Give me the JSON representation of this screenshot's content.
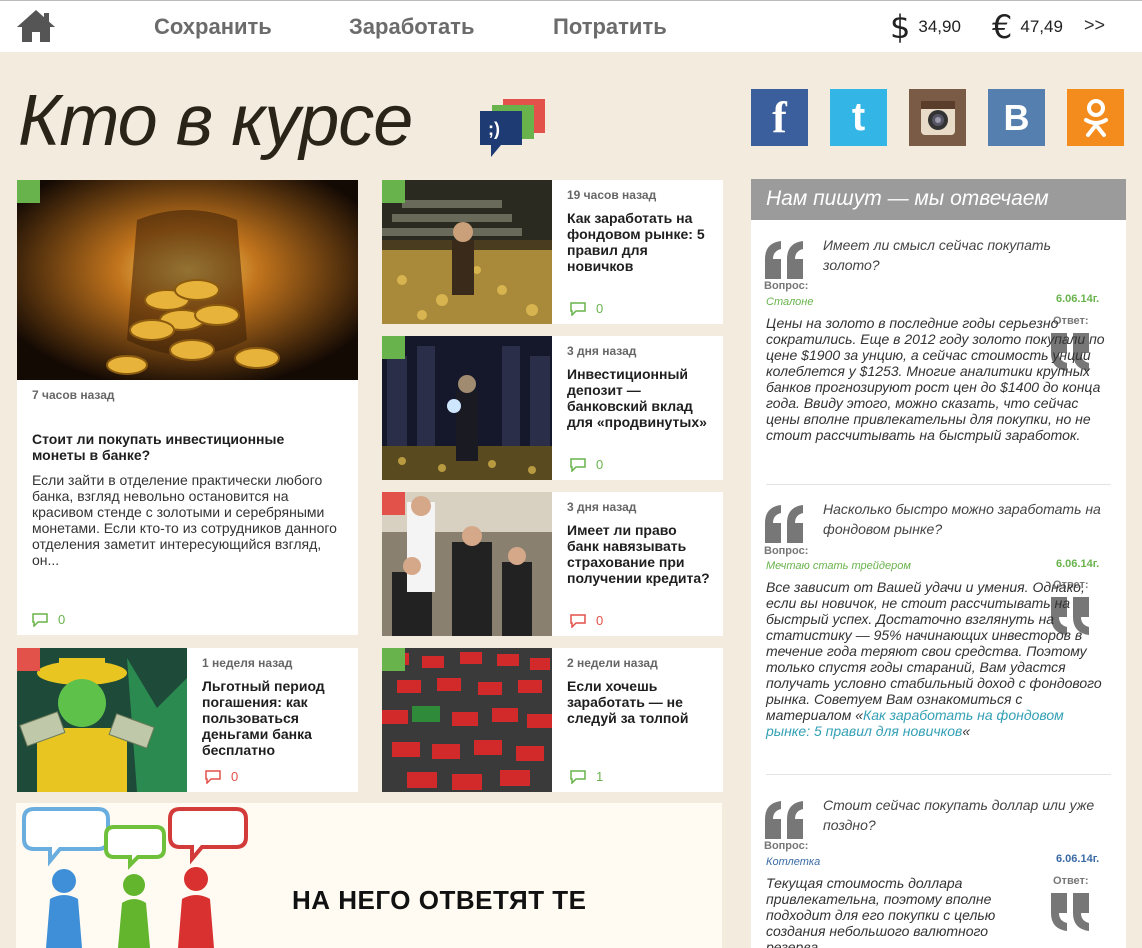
{
  "nav": {
    "items": [
      "Сохранить",
      "Заработать",
      "Потратить"
    ]
  },
  "currency": {
    "usd_symbol": "$",
    "usd_value": "34,90",
    "eur_symbol": "€",
    "eur_value": "47,49",
    "more": ">>"
  },
  "site": {
    "title": "Кто в курсе",
    "bubble_text": ";)"
  },
  "social": [
    "facebook-icon",
    "twitter-icon",
    "instagram-icon",
    "vk-icon",
    "odnoklassniki-icon"
  ],
  "articles": [
    {
      "time": "7 часов назад",
      "title": "Стоит ли покупать инвестиционные монеты в банке?",
      "excerpt": "Если зайти в отделение практически любого банка, взгляд невольно остановится на красивом стенде с золотыми и серебряными монетами.  Если кто-то из сотрудников данного отделения заметит интересующийся взгляд, он...",
      "comments": "0"
    },
    {
      "time": "19 часов назад",
      "title": "Как заработать на фондовом рынке: 5 правил для новичков",
      "comments": "0"
    },
    {
      "time": "3 дня назад",
      "title": "Инвестиционный депозит — банковский вклад для «продвинутых»",
      "comments": "0"
    },
    {
      "time": "3 дня назад",
      "title": "Имеет ли право банк навязывать страхование при получении кредита?",
      "comments": "0"
    },
    {
      "time": "1 неделя назад",
      "title": "Льготный период погашения: как пользоваться деньгами банка бесплатно",
      "comments": "0"
    },
    {
      "time": "2 недели назад",
      "title": "Если хочешь заработать — не следуй за толпой",
      "comments": "1"
    }
  ],
  "banner": {
    "text": "НА НЕГО ОТВЕТЯТ ТЕ"
  },
  "sidebar": {
    "title": "Нам пишут — мы отвечаем",
    "question_label": "Вопрос:",
    "answer_label": "Ответ:",
    "items": [
      {
        "question": "Имеет ли смысл сейчас покупать золото?",
        "author": "Сталоне",
        "date": "6.06.14г.",
        "answer": "Цены на золото в последние годы серьезно сократились. Еще в 2012 году золото покупали по цене $1900 за унцию, а сейчас стоимость унции колеблется у $1253. Многие аналитики крупных банков прогнозируют рост цен до $1400 до конца года. Ввиду этого, можно сказать, что сейчас цены вполне привлекательны для покупки, но не стоит рассчитывать на быстрый заработок."
      },
      {
        "question": "Насколько быстро можно заработать на фондовом рынке?",
        "author": "Мечтаю стать трейдером",
        "date": "6.06.14г.",
        "answer_pre": "Все зависит от Вашей удачи и умения. Однако, если вы новичок, не стоит рассчитывать на быстрый успех. Достаточно взглянуть на статистику — 95% начинающих инвесторов в течение года теряют свои средства. Поэтому только спустя годы стараний, Вам удастся получать условно стабильный доход с фондового рынка. Советуем Вам ознакомиться с материалом «",
        "answer_link": "Как заработать на фондовом рынке: 5 правил для новичков",
        "answer_post": "«"
      },
      {
        "question": "Стоит сейчас покупать доллар или уже поздно?",
        "author": "Котлетка",
        "date": "6.06.14г.",
        "answer": "Текущая стоимость доллара привлекательна, поэтому вполне подходит для его покупки с целью создания небольшого валютного резерва."
      }
    ]
  },
  "colors": {
    "green": "#69b34c",
    "red": "#e2514a",
    "bg": "#f3ebdd",
    "sidebar_head": "#9b9b9b",
    "link": "#33a0b5"
  }
}
